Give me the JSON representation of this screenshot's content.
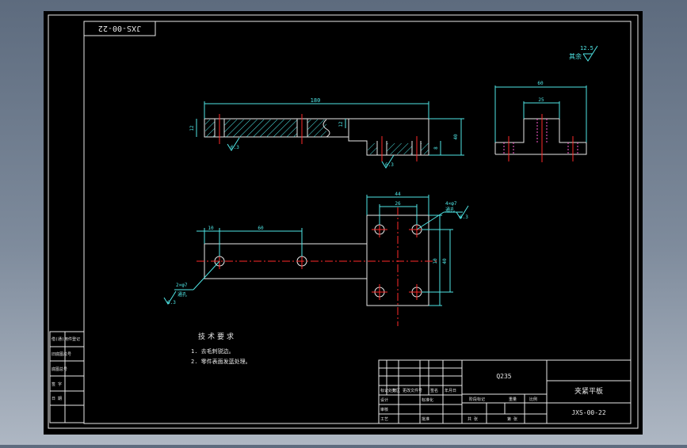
{
  "drawing": {
    "code_box": "JXS-00-22",
    "roughness_top": "12.5",
    "roughness_top_prefix": "其余",
    "front_view": {
      "dim_overall_width": "180",
      "dim_left_height": "12",
      "dim_step": "12",
      "dim_right_height": "40",
      "dim_right_small": "8",
      "roughness_left": "6.3",
      "roughness_mid": "6.3"
    },
    "side_view": {
      "dim_width": "60",
      "dim_slot": "25"
    },
    "top_view": {
      "dim_44": "44",
      "dim_26": "26",
      "dim_10": "10",
      "dim_60": "60",
      "dim_right_inner": "10",
      "dim_right_outer": "40",
      "hole_note_right": "4×φ7",
      "hole_note_right_tag": "通孔",
      "roughness_right": "6.3",
      "hole_note_left": "2×φ7",
      "hole_note_left_tag": "通孔",
      "roughness_left": "6.3"
    },
    "requirements": {
      "title": "技术要求",
      "items": [
        "1. 去毛刺锐边。",
        "2. 零件表面发蓝处理。"
      ]
    },
    "side_table": {
      "rows": [
        "借(通)用件登记",
        "旧底图总号",
        "底图总号",
        "签 字",
        "日 期"
      ]
    },
    "title_block": {
      "material": "Q235",
      "part_name": "夹紧平板",
      "drawing_no": "JXS-00-22",
      "label_mark": "标记",
      "label_count": "处数",
      "label_zone": "分区",
      "label_change_doc": "更改文件号",
      "label_sign": "签名",
      "label_date": "年月日",
      "label_design": "设计",
      "label_check": "审核",
      "label_process": "工艺",
      "label_standard": "标准化",
      "label_approve": "批准",
      "label_stage": "阶段标记",
      "label_weight": "重量",
      "label_scale": "比例",
      "label_sheet": "共 张",
      "label_sheet2": "第 张"
    }
  }
}
